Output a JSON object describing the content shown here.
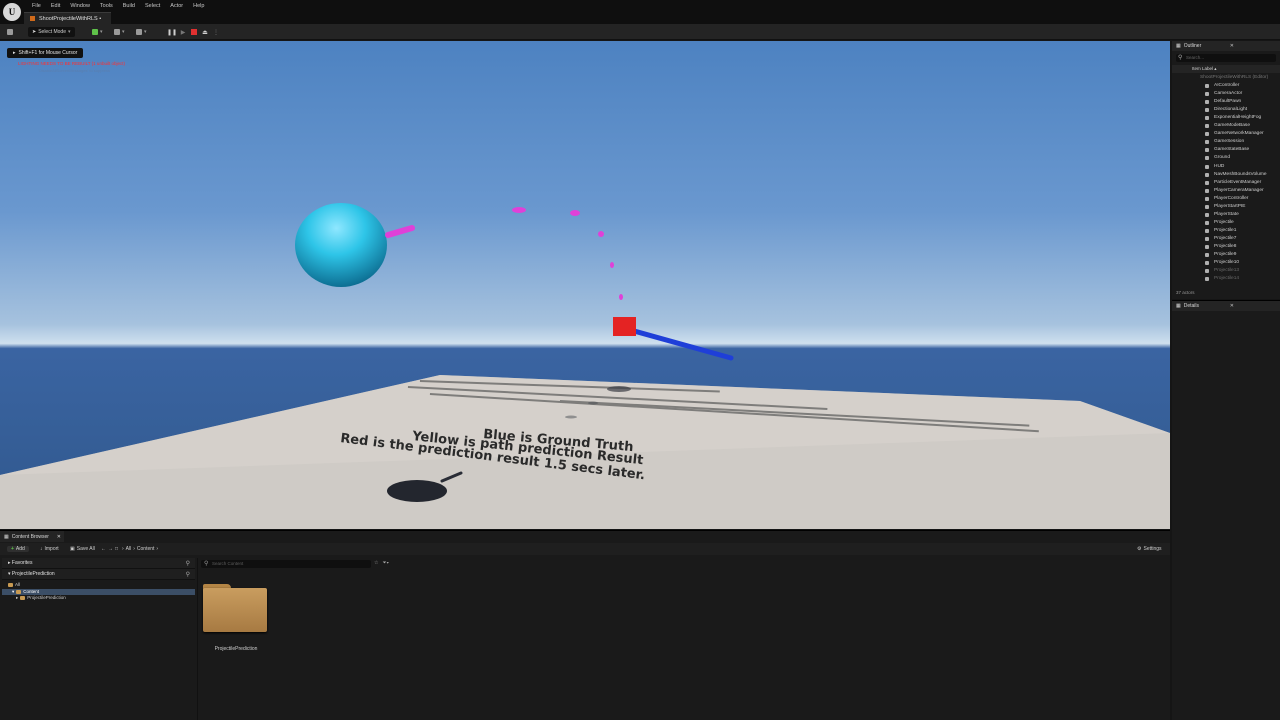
{
  "app": {
    "logo_icon": "unreal-engine-logo",
    "menu": [
      "File",
      "Edit",
      "Window",
      "Tools",
      "Build",
      "Select",
      "Actor",
      "Help"
    ],
    "doc_tab": "ShootProjectileWithRLS •"
  },
  "toolbar": {
    "select_mode": "Select Mode",
    "icons": [
      "save-icon",
      "add-actor-icon",
      "blueprint-icon",
      "cinematics-icon"
    ],
    "play_controls": [
      "pause-icon",
      "skip-frame-icon",
      "stop-icon",
      "eject-icon",
      "more-icon"
    ]
  },
  "viewport": {
    "hint": "Shift+F1 for Mouse Cursor",
    "warning": "LIGHTING NEEDS TO BE REBUILT (1 unbuilt object)",
    "warning2": "'DisableAllScreenMessages' to suppress",
    "floor_text": [
      "Blue is Ground Truth",
      "Yellow is path prediction Result",
      "Red is the prediction result 1.5 secs later."
    ],
    "colors": {
      "sphere": "#2ec5e8",
      "prediction_dots": "#e040d8",
      "ground_truth": "#1f3fd8",
      "red_box": "#e42323"
    }
  },
  "outliner": {
    "title": "Outliner",
    "search_placeholder": "Search...",
    "column": "Item Label ▴",
    "root": "ShootProjectileWithRLS (Editor)",
    "items": [
      "AIController",
      "CameraActor",
      "DefaultPawn",
      "DirectionalLight",
      "ExponentialHeightFog",
      "GameModeBase",
      "GameNetworkManager",
      "GameSession",
      "GameStateBase",
      "Ground",
      "HUD",
      "NavMeshBoundsVolume",
      "ParticleEventManager",
      "PlayerCameraManager",
      "PlayerController",
      "PlayerStartPIE",
      "PlayerState",
      "Projectile",
      "Projectile1",
      "Projectile7",
      "Projectile8",
      "Projectile9",
      "Projectile10",
      "Projectile13",
      "Projectile14"
    ],
    "count": "37 actors"
  },
  "details": {
    "title": "Details"
  },
  "content_browser": {
    "title": "Content Browser",
    "add": "Add",
    "import": "Import",
    "save_all": "Save All",
    "path": [
      "All",
      "Content"
    ],
    "settings": "Settings",
    "favorites": "Favorites",
    "project": "ProjectilePrediction",
    "tree": [
      "All",
      "Content",
      "ProjectilePrediction"
    ],
    "search_placeholder": "Search Content",
    "folder": "ProjectilePrediction"
  }
}
